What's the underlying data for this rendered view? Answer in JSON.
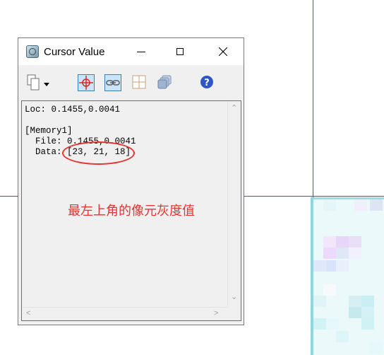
{
  "window": {
    "title": "Cursor Value"
  },
  "toolbar": {
    "items": [
      {
        "icon": "copy-icon"
      },
      {
        "icon": "dropdown-arrow-icon"
      },
      {
        "icon": "crosshair-icon",
        "active": true
      },
      {
        "icon": "link-icon",
        "active": true
      },
      {
        "icon": "grid-icon"
      },
      {
        "icon": "stacked-windows-icon"
      },
      {
        "icon": "help-icon"
      }
    ]
  },
  "content": {
    "loc_line": "Loc: 0.1455,0.0041",
    "memory_header": "[Memory1]",
    "file_line": "  File: 0.1455,0.0041",
    "data_line": "  Data: [23, 21, 18]"
  },
  "annotation": {
    "text": "最左上角的像元灰度值",
    "color": "#e3342f"
  },
  "colors": {
    "crosshair": "#e02020",
    "active_tool_bg": "#cce4f7",
    "window_bg": "#f0f0f0"
  }
}
